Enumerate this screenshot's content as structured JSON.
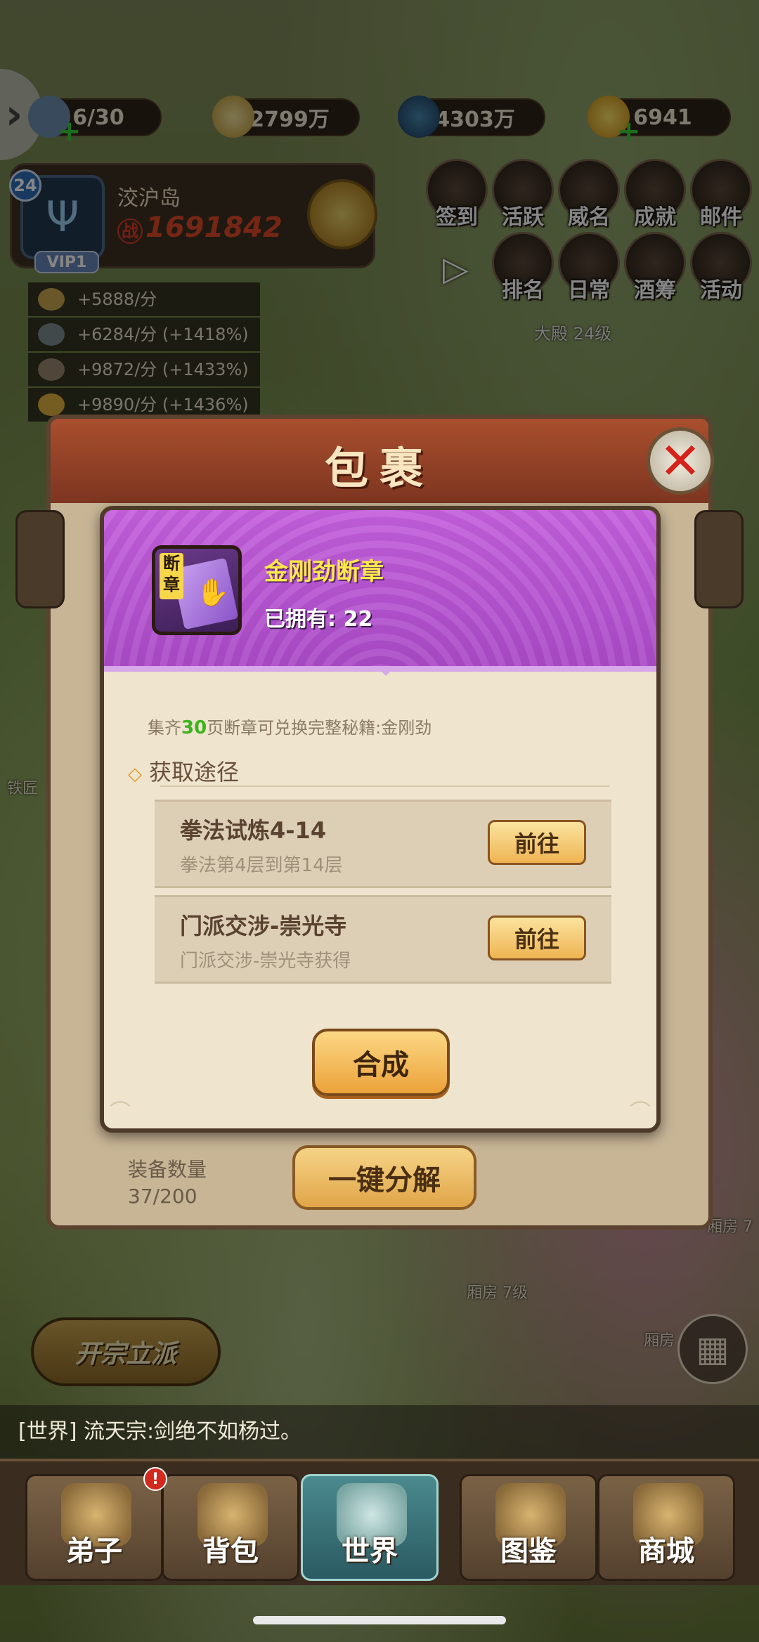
{
  "resources": [
    {
      "icon": "stamina-icon",
      "value": "6/30"
    },
    {
      "icon": "silver-ingot-icon",
      "value": "2799万"
    },
    {
      "icon": "coin-icon",
      "value": "4303万"
    },
    {
      "icon": "gold-ingot-icon",
      "value": "6941"
    }
  ],
  "player": {
    "level": "24",
    "name": "洨沪岛",
    "power_tag": "战",
    "power": "1691842",
    "vip": "VIP1"
  },
  "income": [
    {
      "text": "+5888/分"
    },
    {
      "text": "+6284/分 (+1418%)"
    },
    {
      "text": "+9872/分 (+1433%)"
    },
    {
      "text": "+9890/分 (+1436%)"
    }
  ],
  "menu": [
    "签到",
    "活跃",
    "威名",
    "成就",
    "邮件",
    "排名",
    "日常",
    "酒筹",
    "活动"
  ],
  "hall_label": "大殿 24级",
  "bag": {
    "title": "包裹",
    "equip_label": "装备数量",
    "equip_count": "37/200",
    "decompose": "一键分解"
  },
  "item": {
    "tag": "断章",
    "name": "金刚劲断章",
    "owned": "已拥有: 22",
    "desc_prefix": "集齐",
    "desc_num": "30",
    "desc_suffix": "页断章可兑换完整秘籍:金刚劲",
    "section_title": "获取途径",
    "routes": [
      {
        "name": "拳法试炼4-14",
        "sub": "拳法第4层到第14层",
        "button": "前往"
      },
      {
        "name": "门派交涉-崇光寺",
        "sub": "门派交涉-崇光寺获得",
        "button": "前往"
      }
    ],
    "craft": "合成"
  },
  "side": {
    "smith": "铁匠",
    "room1": "厢房 7级",
    "room2": "厢房",
    "room3": "厢房 7"
  },
  "sect_button": "开宗立派",
  "chat": "[世界] 流天宗:剑绝不如杨过。",
  "nav": [
    {
      "label": "弟子",
      "badge": ""
    },
    {
      "label": "背包",
      "badge": "!"
    },
    {
      "label": "世界",
      "badge": ""
    },
    {
      "label": "图鉴",
      "badge": ""
    },
    {
      "label": "商城",
      "badge": ""
    }
  ],
  "colors": {
    "item_purple": "#b14fcf",
    "item_name": "#ffe94a",
    "desc_highlight": "#3cb31c",
    "button_gold": "#eeb452",
    "panel_bg": "#efe4ce"
  }
}
